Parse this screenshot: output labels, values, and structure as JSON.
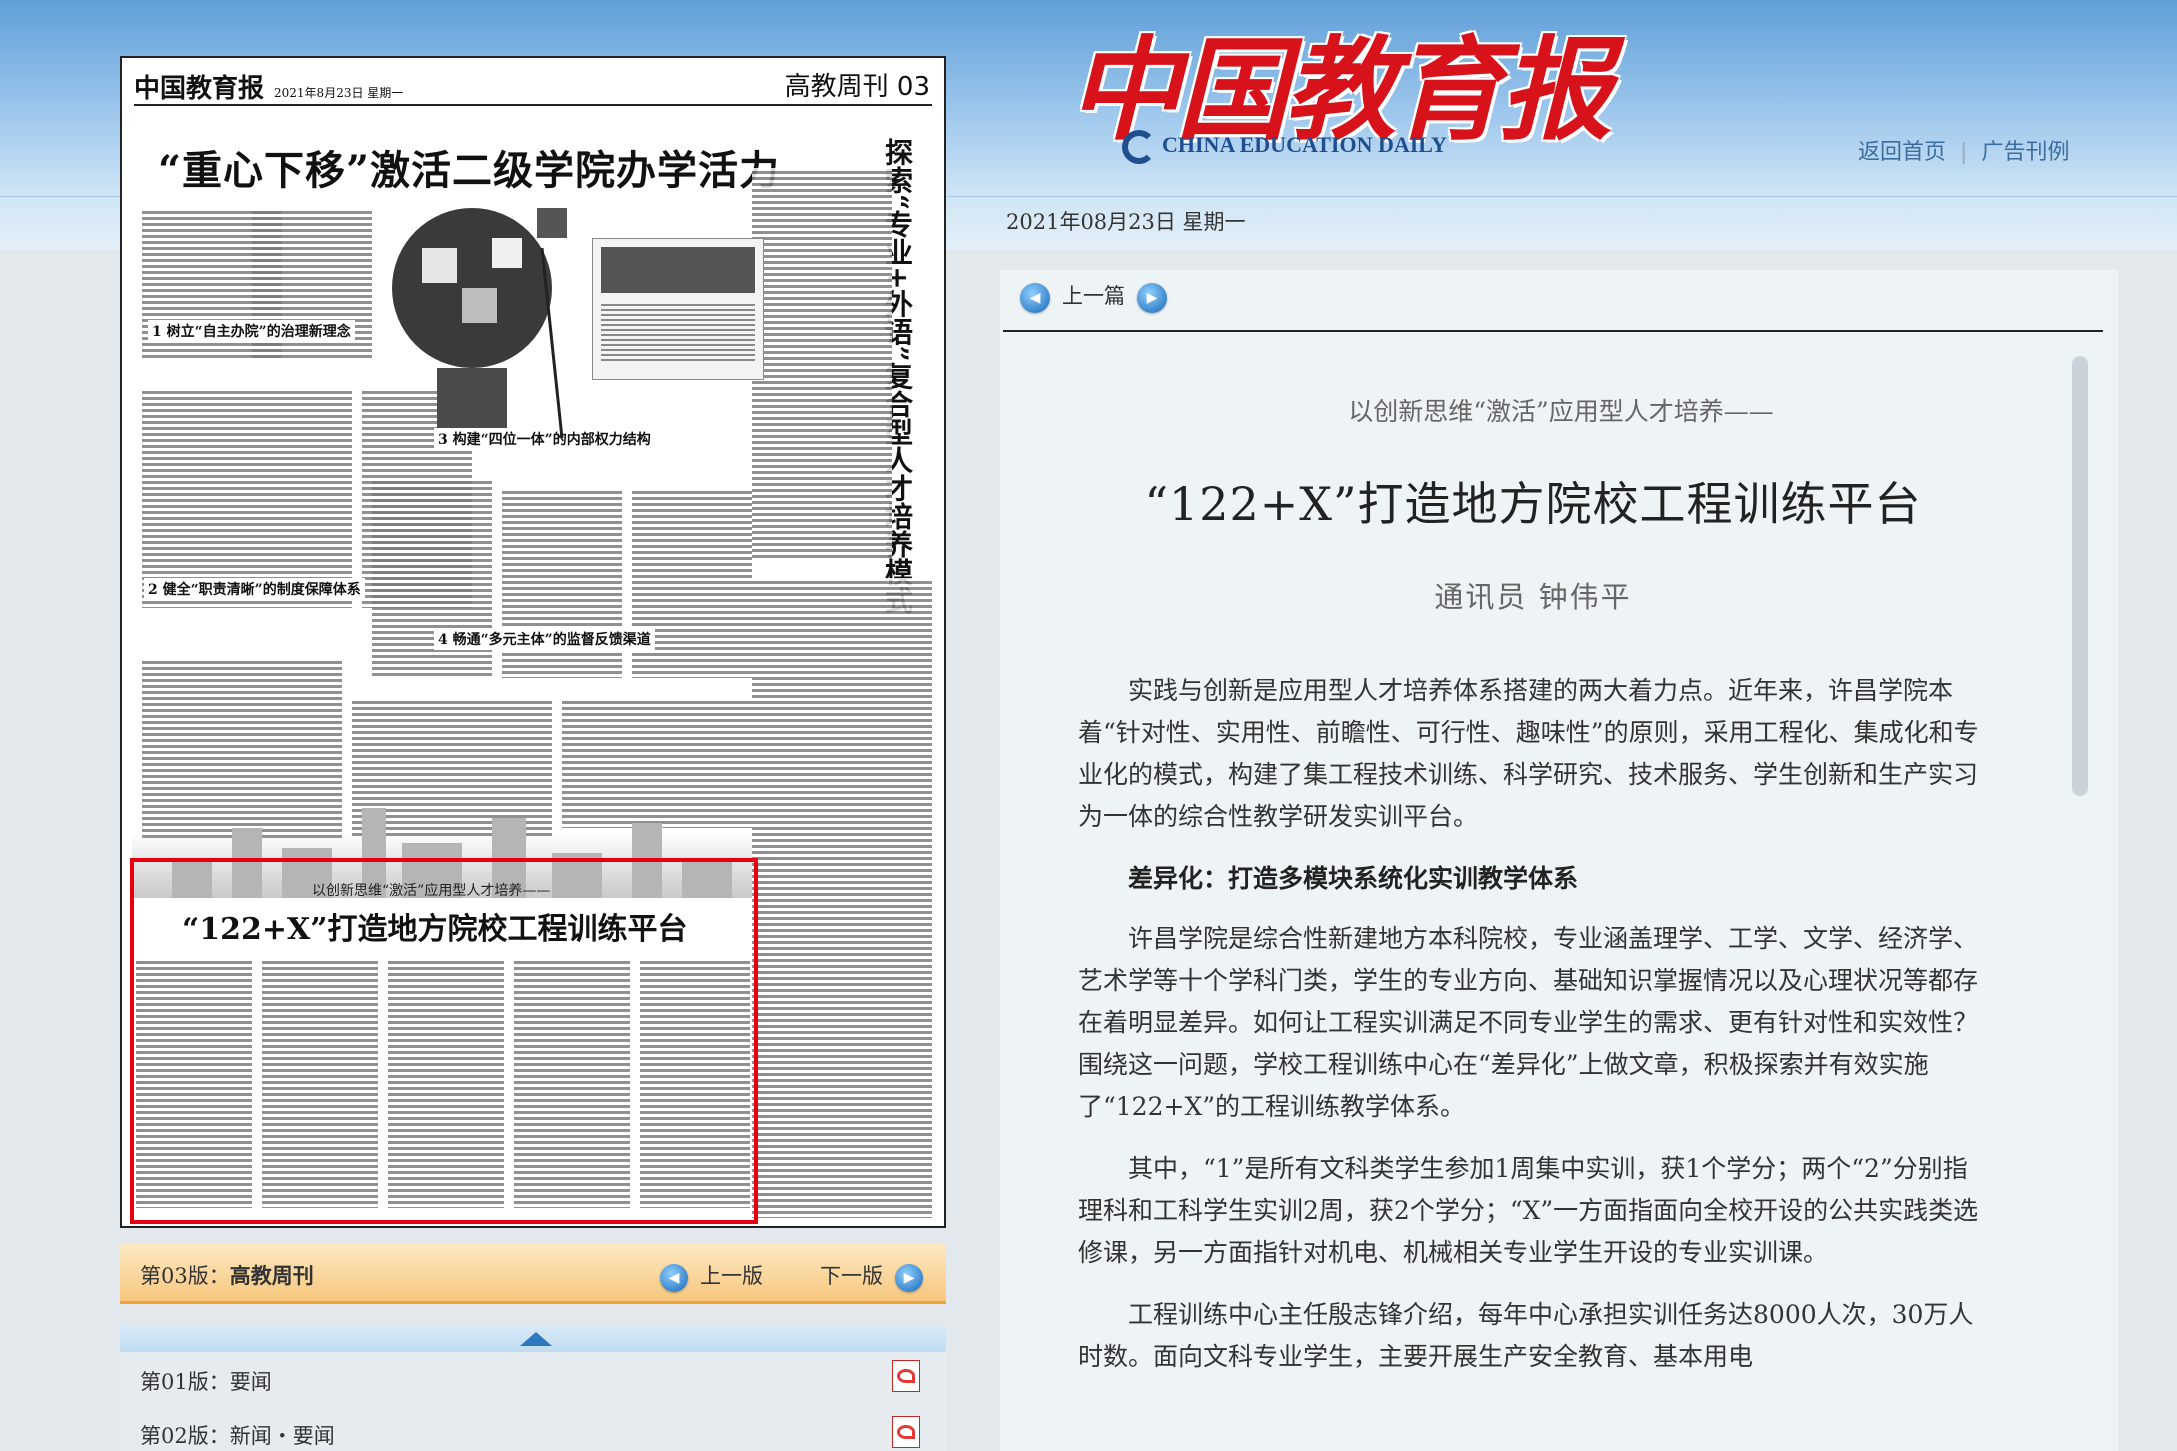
{
  "site": {
    "logo_cn": "中国教育报",
    "logo_en": "CHINA EDUCATION DAILY",
    "nav": [
      "返回首页",
      "广告刊例"
    ],
    "date": "2021年08月23日  星期一"
  },
  "newspaper": {
    "masthead": "中国教育报",
    "masthead_date": "2021年8月23日  星期一",
    "page_name": "高教周刊",
    "page_no": "03",
    "headline_top": "“重心下移”激活二级学院办学活力",
    "side_title": "探索“专业+外语”复合型人才培养模式",
    "subheads": [
      "1 树立“自主办院”的治理新理念",
      "2 健全“职责清晰”的制度保障体系",
      "3 构建“四位一体”的内部权力结构",
      "4 畅通“多元主体”的监督反馈渠道"
    ],
    "highlight_kicker": "以创新思维“激活”应用型人才培养——",
    "highlight_title": "“122+X”打造地方院校工程训练平台"
  },
  "edition_bar": {
    "label_prefix": "第03版：",
    "label_name": "高教周刊",
    "prev": "上一版",
    "next": "下一版"
  },
  "page_list": [
    {
      "label": "第01版：要闻"
    },
    {
      "label": "第02版：新闻・要闻"
    }
  ],
  "article": {
    "prev_link": "上一篇",
    "kicker": "以创新思维“激活”应用型人才培养——",
    "title": "“122+X”打造地方院校工程训练平台",
    "byline": "通讯员  钟伟平",
    "paragraphs": [
      {
        "type": "p",
        "text": "实践与创新是应用型人才培养体系搭建的两大着力点。近年来，许昌学院本着“针对性、实用性、前瞻性、可行性、趣味性”的原则，采用工程化、集成化和专业化的模式，构建了集工程技术训练、科学研究、技术服务、学生创新和生产实习为一体的综合性教学研发实训平台。"
      },
      {
        "type": "h",
        "text": "差异化：打造多模块系统化实训教学体系"
      },
      {
        "type": "p",
        "text": "许昌学院是综合性新建地方本科院校，专业涵盖理学、工学、文学、经济学、艺术学等十个学科门类，学生的专业方向、基础知识掌握情况以及心理状况等都存在着明显差异。如何让工程实训满足不同专业学生的需求、更有针对性和实效性？围绕这一问题，学校工程训练中心在“差异化”上做文章，积极探索并有效实施了“122+X”的工程训练教学体系。"
      },
      {
        "type": "p",
        "text": "其中，“1”是所有文科类学生参加1周集中实训，获1个学分；两个“2”分别指理科和工科学生实训2周，获2个学分；“X”一方面指面向全校开设的公共实践类选修课，另一方面指针对机电、机械相关专业学生开设的专业实训课。"
      },
      {
        "type": "p",
        "text": "工程训练中心主任殷志锋介绍，每年中心承担实训任务达8000人次，30万人时数。面向文科专业学生，主要开展生产安全教育、基本用电"
      }
    ]
  }
}
